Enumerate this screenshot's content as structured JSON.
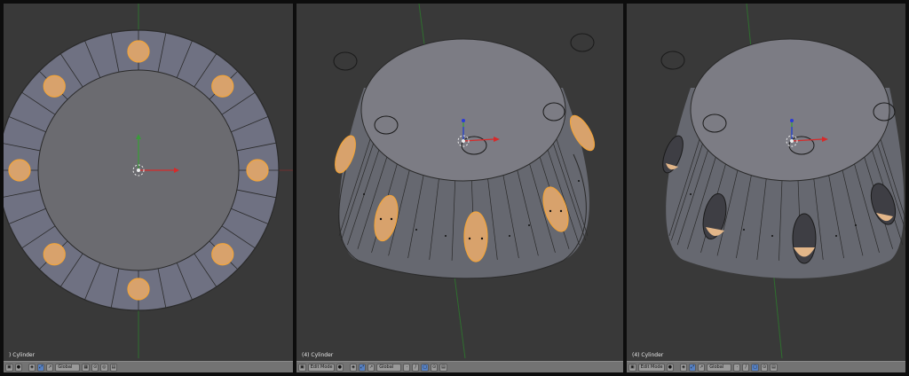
{
  "viewports": [
    {
      "object_label": ") Cylinder",
      "mode": "",
      "orientation": "Global"
    },
    {
      "object_label": "(4) Cylinder",
      "mode": "Edit Mode",
      "orientation": "Global"
    },
    {
      "object_label": "(4) Cylinder",
      "mode": "Edit Mode",
      "orientation": "Global"
    }
  ],
  "colors": {
    "viewport_bg": "#393939",
    "selection": "#d8a26c",
    "selection_edge": "#f2a43a",
    "x_axis": "#d72a2a",
    "y_axis": "#3a9a3a",
    "z_axis": "#2a3ad8",
    "header_bg": "#737373"
  }
}
